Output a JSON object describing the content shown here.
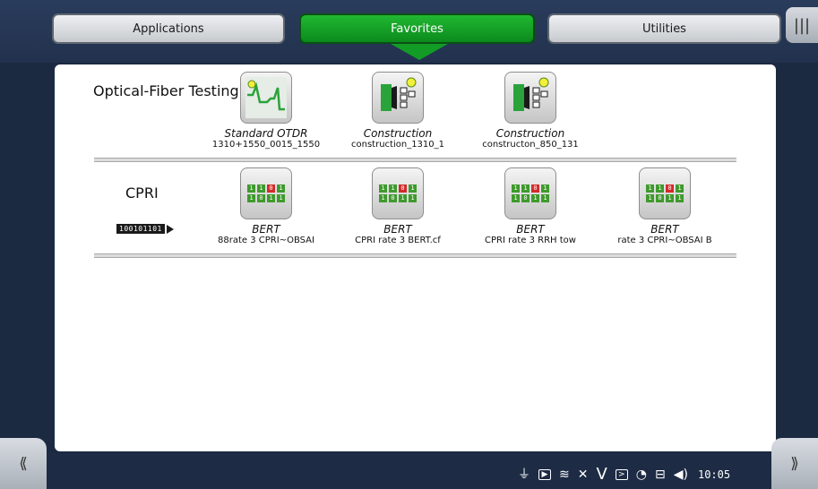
{
  "tabs": [
    {
      "label": "Applications",
      "active": false
    },
    {
      "label": "Favorites",
      "active": true
    },
    {
      "label": "Utilities",
      "active": false
    }
  ],
  "menu_icon": "menu-bars-icon",
  "categories": [
    {
      "label": "Optical-Fiber Testing",
      "apps": [
        {
          "name": "Standard OTDR",
          "file": "1310+1550_0015_1550",
          "icon": "otdr-trace-icon"
        },
        {
          "name": "Construction",
          "file": "construction_1310_1",
          "icon": "fiber-construction-icon"
        },
        {
          "name": "Construction",
          "file": "constructon_850_131",
          "icon": "fiber-construction-icon"
        }
      ]
    },
    {
      "label": "CPRI",
      "bit_strip": "100101101",
      "apps": [
        {
          "name": "BERT",
          "file": "88rate 3 CPRI~OBSAI",
          "icon": "bert-bits-icon"
        },
        {
          "name": "BERT",
          "file": "CPRI rate 3 BERT.cf",
          "icon": "bert-bits-icon"
        },
        {
          "name": "BERT",
          "file": "CPRI rate 3 RRH tow",
          "icon": "bert-bits-icon"
        },
        {
          "name": "BERT",
          "file": "rate 3 CPRI~OBSAI B",
          "icon": "bert-bits-icon"
        }
      ]
    }
  ],
  "bits_icon": {
    "row1": [
      "1",
      "1",
      "0",
      "1"
    ],
    "row2": [
      "1",
      "0",
      "1",
      "1"
    ]
  },
  "nav": {
    "left_label": "⟪",
    "right_label": "⟫"
  },
  "status": {
    "icons": [
      "power-plug-icon",
      "battery-icon",
      "wifi-icon",
      "bluetooth-off-icon",
      "v-icon",
      "terminal-icon",
      "satellite-icon",
      "network-icon",
      "speaker-icon"
    ],
    "time": "10:05"
  },
  "colors": {
    "active_tab": "#129c26",
    "background": "#1c2a41"
  }
}
